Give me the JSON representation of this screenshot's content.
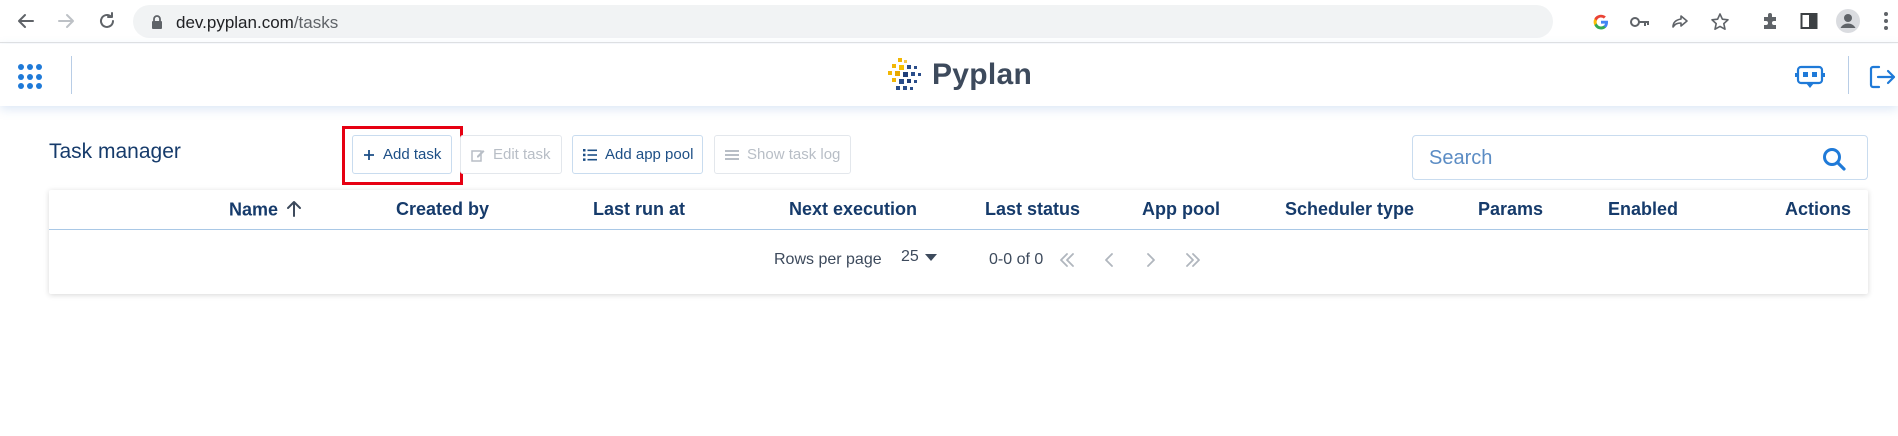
{
  "browser": {
    "url_domain": "dev.pyplan.com",
    "url_path": "/tasks"
  },
  "header": {
    "logo_text": "Pyplan"
  },
  "toolbar": {
    "title": "Task manager",
    "add_task_label": "Add task",
    "edit_task_label": "Edit task",
    "add_app_pool_label": "Add app pool",
    "show_task_log_label": "Show task log",
    "search_placeholder": "Search"
  },
  "table": {
    "columns": [
      "Name",
      "Created by",
      "Last run at",
      "Next execution",
      "Last status",
      "App pool",
      "Scheduler type",
      "Params",
      "Enabled",
      "Actions"
    ],
    "sort_column": "Name",
    "sort_direction": "ascending",
    "rows": []
  },
  "pagination": {
    "rows_per_page_label": "Rows per page",
    "rows_per_page_value": "25",
    "range_text": "0-0 of 0"
  },
  "colors": {
    "primary": "#1d4f86",
    "title": "#163b6b",
    "highlight": "#e60012",
    "accent_blue": "#1f7ad8"
  }
}
